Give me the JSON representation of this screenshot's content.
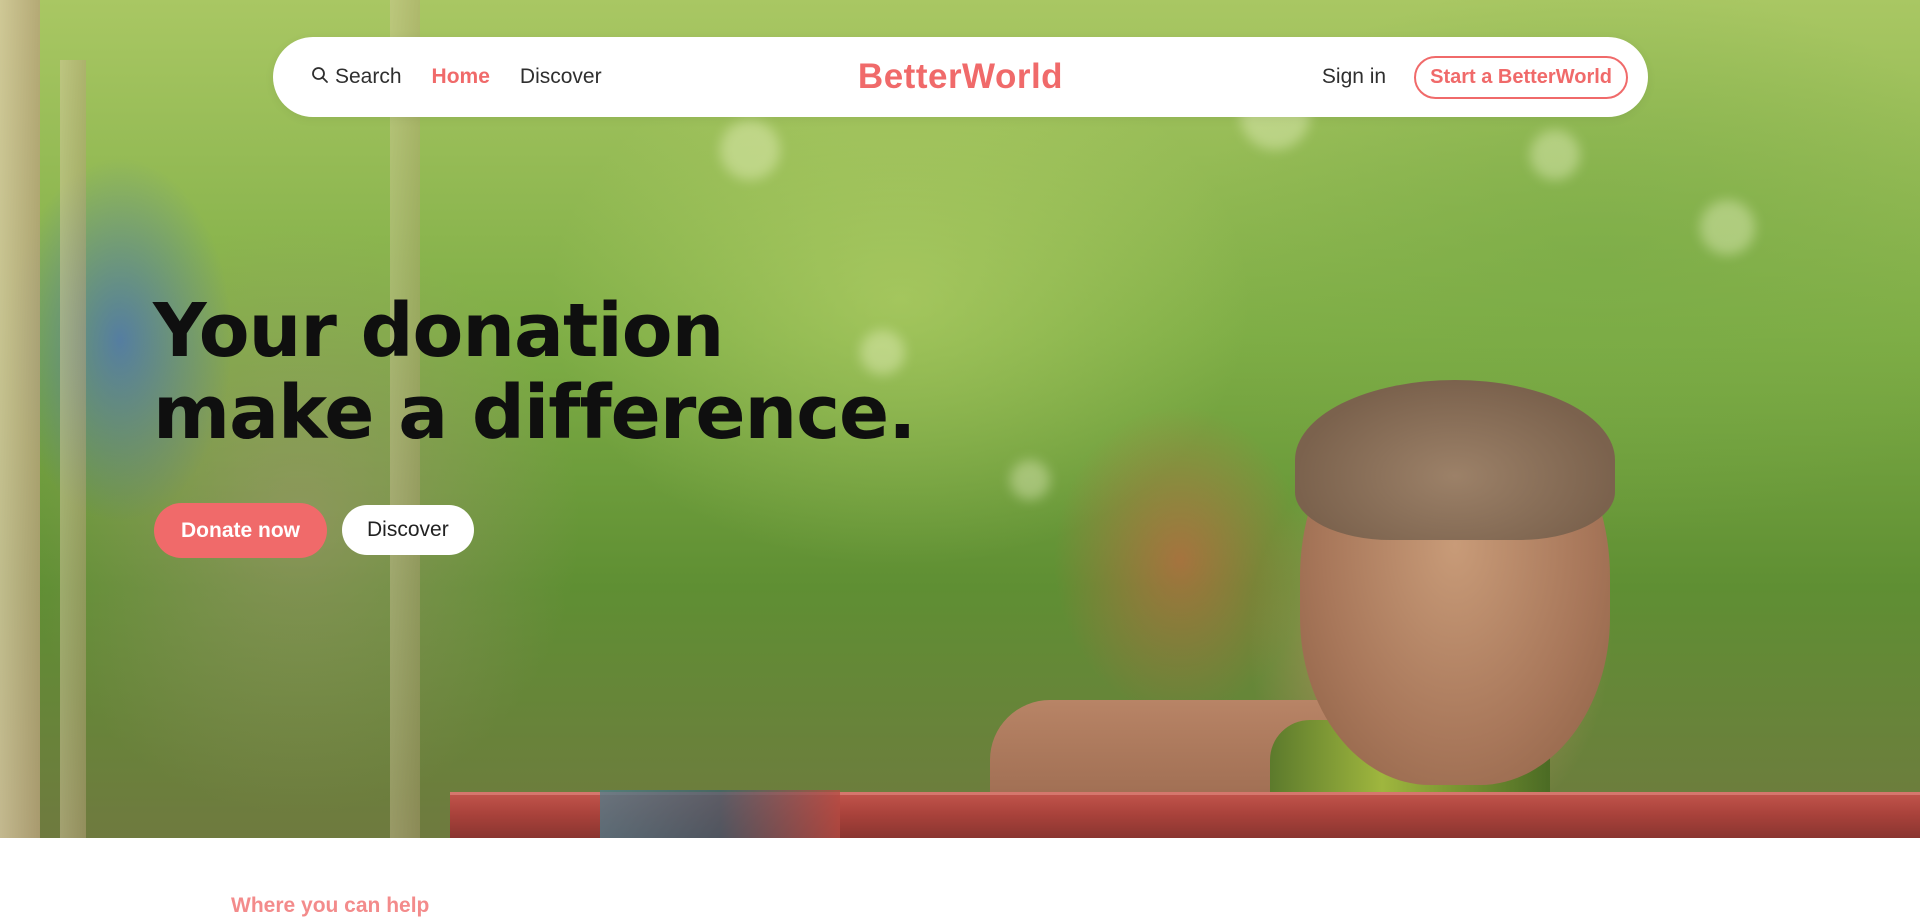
{
  "brand": {
    "name": "BetterWorld",
    "accent_color": "#f06a6a"
  },
  "nav": {
    "search_icon": "search-icon",
    "search_label": "Search",
    "home_label": "Home",
    "discover_label": "Discover",
    "signin_label": "Sign in",
    "start_label": "Start a BetterWorld"
  },
  "hero": {
    "title_line1": "Your donation",
    "title_line2": "make a difference.",
    "donate_label": "Donate now",
    "discover_label": "Discover"
  },
  "section": {
    "label": "Where you can help"
  }
}
